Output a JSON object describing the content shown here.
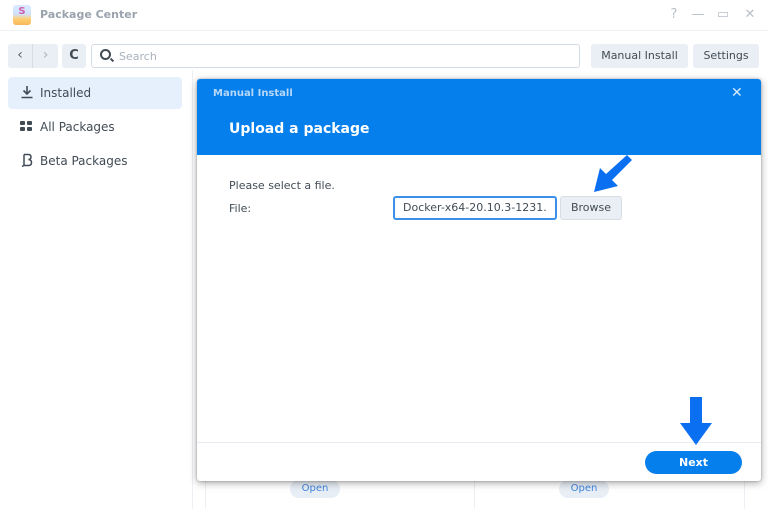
{
  "window": {
    "title": "Package Center",
    "controls": {
      "help": "?",
      "minimize": "—",
      "maximize": "▭",
      "close": "✕"
    }
  },
  "toolbar": {
    "back": "‹",
    "forward": "›",
    "refresh": "C",
    "search_placeholder": "Search",
    "search_value": "",
    "manual_install_label": "Manual Install",
    "settings_label": "Settings"
  },
  "sidebar": {
    "items": [
      {
        "label": "Installed",
        "icon": "download-icon",
        "active": true
      },
      {
        "label": "All Packages",
        "icon": "grid-icon",
        "active": false
      },
      {
        "label": "Beta Packages",
        "icon": "beta-icon",
        "active": false
      }
    ]
  },
  "background": {
    "open_buttons": [
      "Open",
      "Open"
    ]
  },
  "dialog": {
    "title": "Manual Install",
    "close_glyph": "✕",
    "heading": "Upload a package",
    "prompt": "Please select a file.",
    "file_label": "File:",
    "file_value": "Docker-x64-20.10.3-1231.",
    "browse_label": "Browse",
    "next_label": "Next"
  },
  "colors": {
    "accent": "#057feb",
    "arrow": "#0a6ff0",
    "sidebar_active": "#e6f0fc",
    "button_bg": "#eaeff5"
  }
}
